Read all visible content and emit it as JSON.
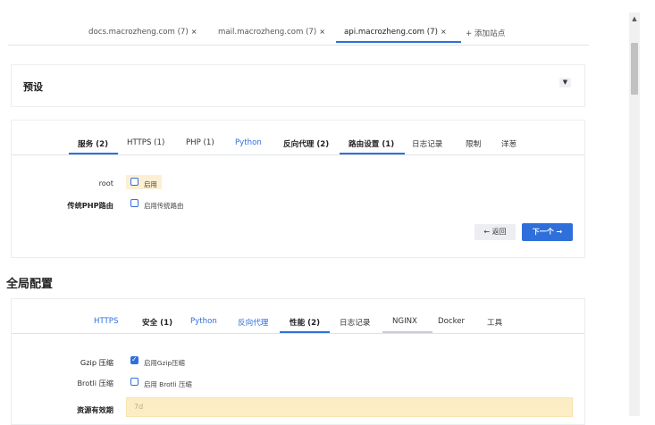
{
  "site_tabs": [
    {
      "label": "docs.macrozheng.com (7)",
      "close": "×"
    },
    {
      "label": "mail.macrozheng.com (7)",
      "close": "×"
    },
    {
      "label": "api.macrozheng.com (7)",
      "close": "×"
    },
    {
      "label": "+ 添加站点"
    }
  ],
  "preset": {
    "title": "预设",
    "toggle_icon": "chevron-down-icon",
    "tabs": [
      {
        "label": "服务 (2)"
      },
      {
        "label": "HTTPS (1)"
      },
      {
        "label": "PHP (1)"
      },
      {
        "label": "Python"
      },
      {
        "label": "反向代理 (2)"
      },
      {
        "label": "路由设置 (1)"
      },
      {
        "label": "日志记录"
      },
      {
        "label": "限制"
      },
      {
        "label": "洋葱"
      }
    ],
    "active_tab": "路由设置 (1)",
    "rows": [
      {
        "label": "root",
        "checkbox_label": "启用",
        "checked": false
      },
      {
        "label": "传统PHP路由",
        "checkbox_label": "启用传统路由",
        "checked": false
      }
    ],
    "back_button": "← 返回",
    "next_button": "下一个 →"
  },
  "global": {
    "title": "全局配置",
    "tabs": [
      {
        "label": "HTTPS"
      },
      {
        "label": "安全 (1)"
      },
      {
        "label": "Python"
      },
      {
        "label": "反向代理"
      },
      {
        "label": "性能 (2)"
      },
      {
        "label": "日志记录"
      },
      {
        "label": "NGINX"
      },
      {
        "label": "Docker"
      },
      {
        "label": "工具"
      }
    ],
    "active_tab": "性能 (2)",
    "rows": [
      {
        "label": "Gzip 压缩",
        "checkbox_label": "启用Gzip压缩",
        "checked": true
      },
      {
        "label": "Brotli 压缩",
        "checkbox_label": "启用 Brotli 压缩",
        "checked": false
      }
    ],
    "expiry_label": "资源有效期",
    "expiry_value": "7d"
  },
  "colors": {
    "accent": "#2f6fdb",
    "highlight": "#fdf0d2",
    "input_bg": "#fcedc4"
  }
}
